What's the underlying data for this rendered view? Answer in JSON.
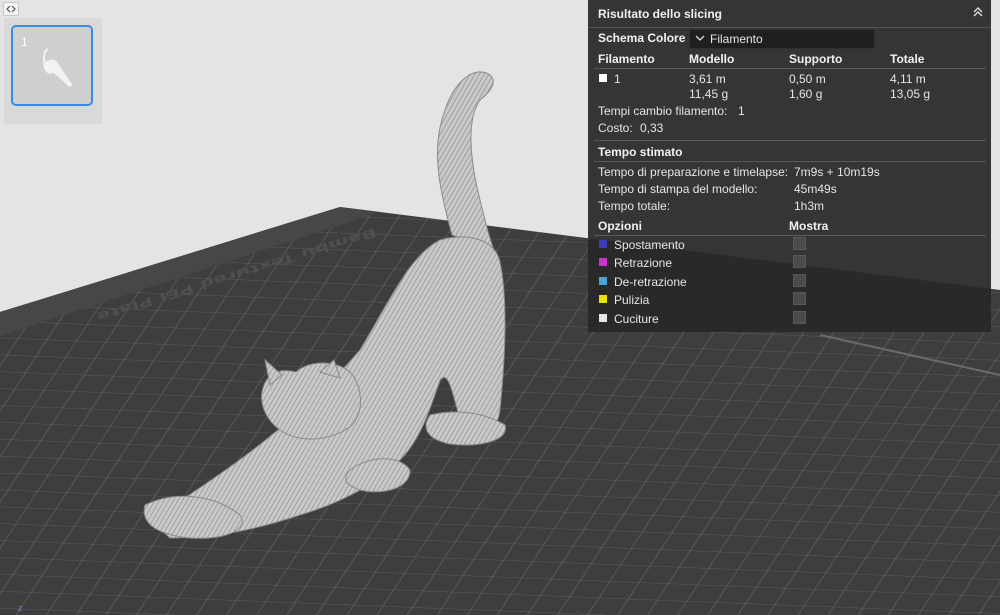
{
  "panel": {
    "title": "Risultato dello slicing",
    "color_scheme_label": "Schema Colore",
    "color_scheme_value": "Filamento",
    "columns": [
      "Filamento",
      "Modello",
      "Supporto",
      "Totale"
    ],
    "filament": {
      "id": "1",
      "swatch_color": "#ffffff",
      "model_length": "3,61 m",
      "model_weight": "11,45 g",
      "support_length": "0,50 m",
      "support_weight": "1,60 g",
      "total_length": "4,11 m",
      "total_weight": "13,05 g"
    },
    "filament_changes_label": "Tempi cambio filamento:",
    "filament_changes_value": "1",
    "cost_label": "Costo:",
    "cost_value": "0,33",
    "time_heading": "Tempo stimato",
    "prep_label": "Tempo di preparazione e timelapse:",
    "prep_value": "7m9s + 10m19s",
    "print_label": "Tempo di stampa del modello:",
    "print_value": "45m49s",
    "total_label": "Tempo totale:",
    "total_value": "1h3m",
    "options_heading": "Opzioni",
    "show_heading": "Mostra",
    "options": [
      {
        "label": "Spostamento",
        "color": "#3b3bb8"
      },
      {
        "label": "Retrazione",
        "color": "#cc33cc"
      },
      {
        "label": "De-retrazione",
        "color": "#4aa6d6"
      },
      {
        "label": "Pulizia",
        "color": "#e6e600"
      },
      {
        "label": "Cuciture",
        "color": "#e6e6e6"
      }
    ]
  },
  "plate": {
    "number": "1",
    "bed_label": "Bambu Textured PEI Plate"
  },
  "axis": {
    "z": "z"
  },
  "icons": [
    "sidebar-toggle-icon",
    "collapse-chevron-icon",
    "dropdown-chevron-icon"
  ]
}
